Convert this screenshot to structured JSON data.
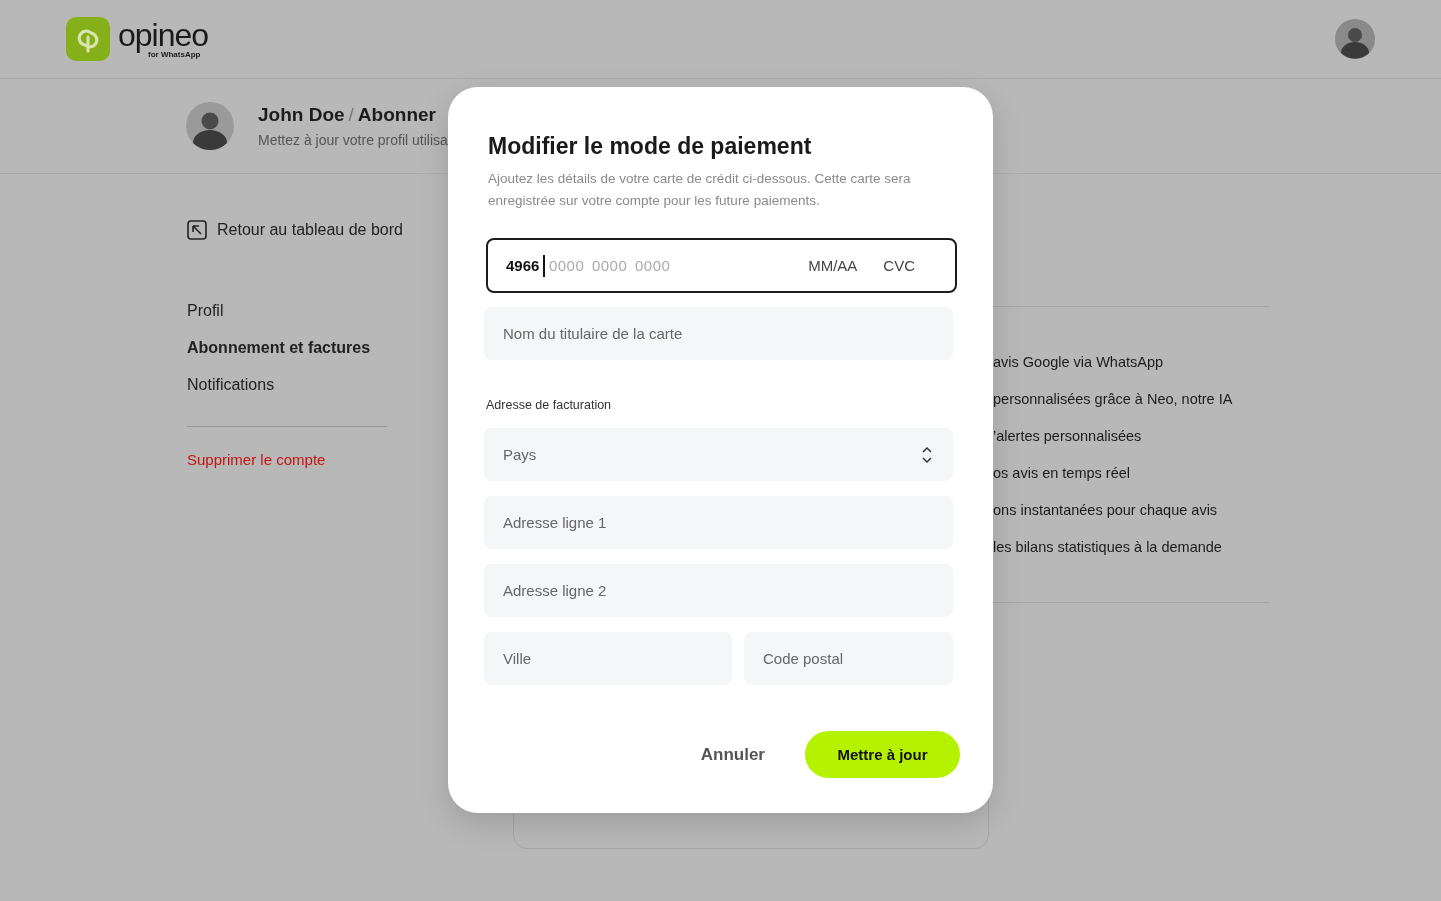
{
  "header": {
    "logo": {
      "name": "opineo",
      "tagline": "for WhatsApp"
    }
  },
  "profile": {
    "name": "John Doe",
    "separator": "/",
    "section": "Abonner",
    "subtitle": "Mettez à jour votre profil utilisa"
  },
  "sidebar": {
    "back_link": "Retour au tableau de bord",
    "items": [
      {
        "label": "Profil",
        "selected": false
      },
      {
        "label": "Abonnement et factures",
        "selected": true
      },
      {
        "label": "Notifications",
        "selected": false
      }
    ],
    "delete_link": "Supprimer le compte"
  },
  "features": [
    "avis Google via WhatsApp",
    "personnalisées grâce à Neo, notre IA",
    "’alertes personnalisées",
    "os avis en temps réel",
    "ons instantanées pour chaque avis",
    "les bilans statistiques à la demande"
  ],
  "modal": {
    "title": "Modifier le mode de paiement",
    "description": "Ajoutez les détails de votre carte de crédit ci-dessous. Cette carte sera enregistrée sur votre compte pour les future paiements.",
    "card": {
      "value": "4966",
      "placeholder": "0000 0000 0000",
      "expiry_placeholder": "MM/AA",
      "cvc_placeholder": "CVC"
    },
    "holder": {
      "placeholder": "Nom du titulaire de la carte"
    },
    "billing_label": "Adresse de facturation",
    "fields": [
      {
        "kind": "select",
        "placeholder": "Pays"
      },
      {
        "kind": "text",
        "placeholder": "Adresse ligne 1"
      },
      {
        "kind": "text",
        "placeholder": "Adresse ligne 2"
      }
    ],
    "row_fields": [
      {
        "placeholder": "Ville"
      },
      {
        "placeholder": "Code postal"
      }
    ],
    "cancel": "Annuler",
    "submit": "Mettre à jour"
  }
}
